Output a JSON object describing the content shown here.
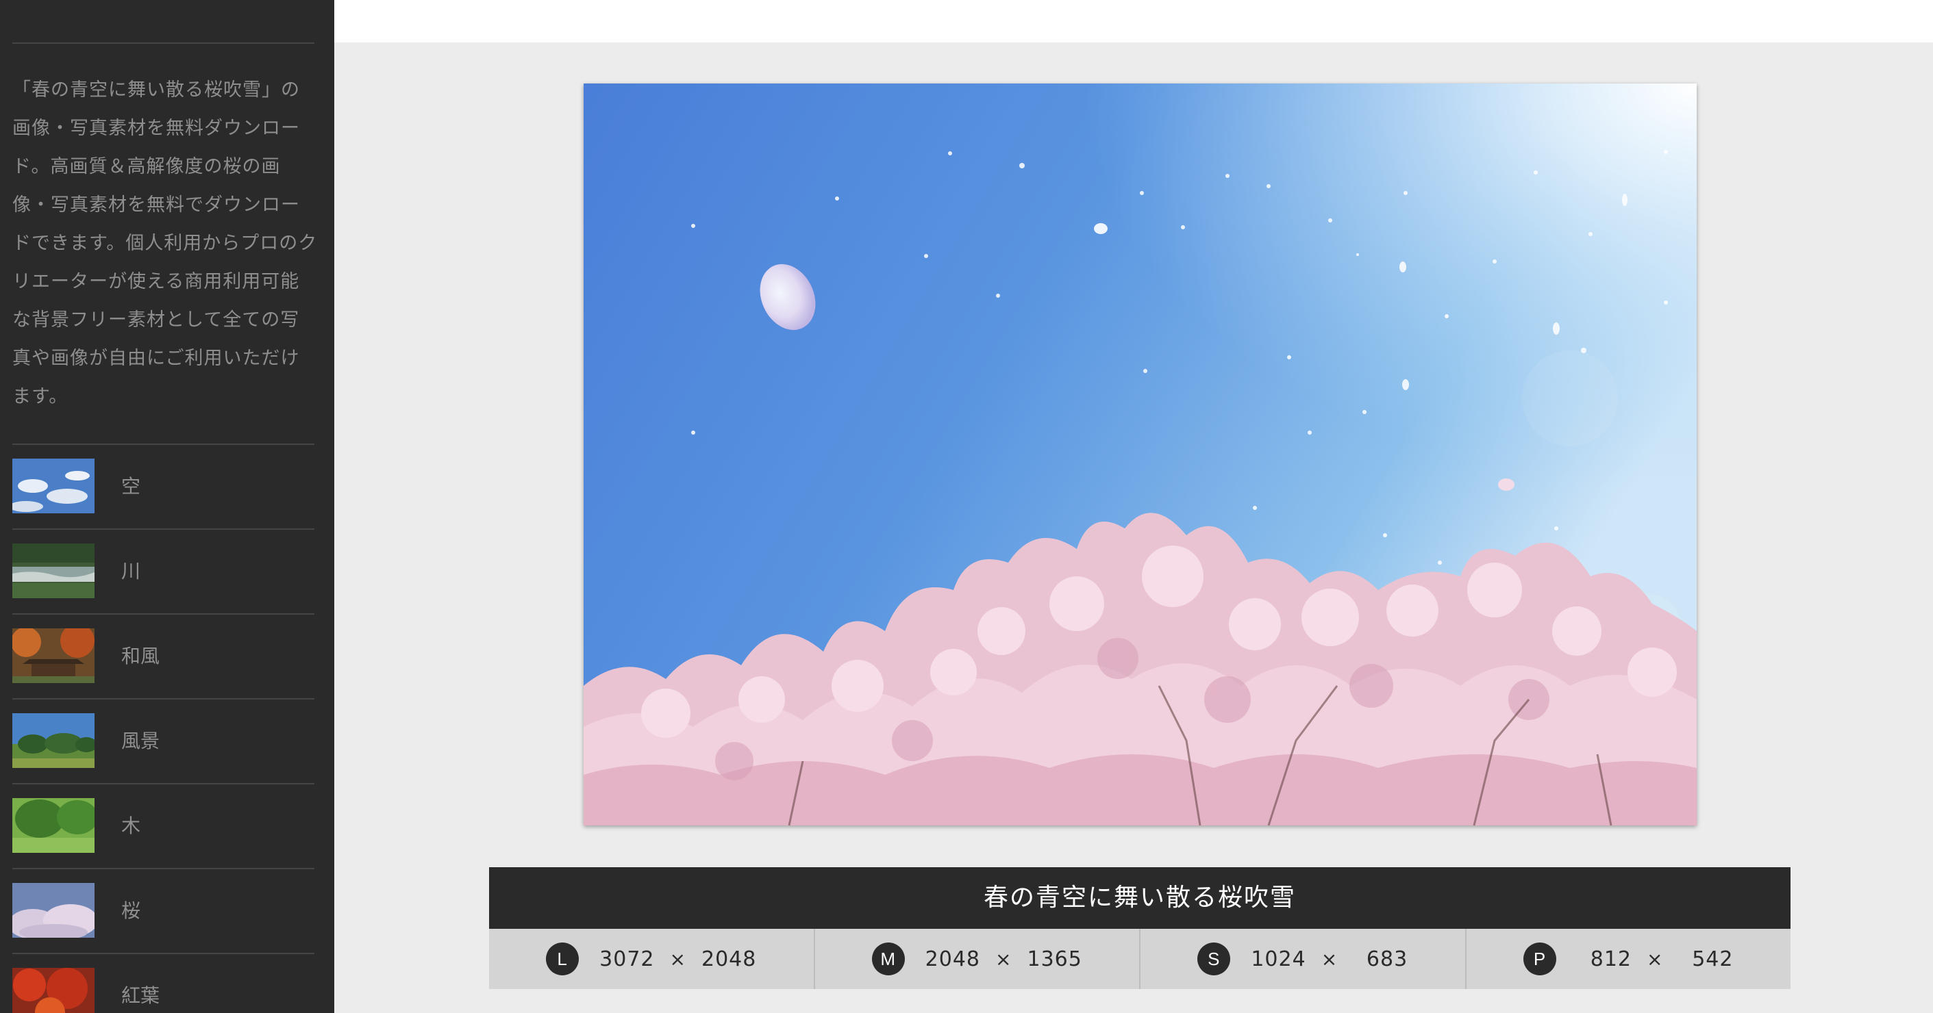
{
  "sidebar": {
    "description": "「春の青空に舞い散る桜吹雪」の画像・写真素材を無料ダウンロード。高画質＆高解像度の桜の画像・写真素材を無料でダウンロードできます。個人利用からプロのクリエーターが使える商用利用可能な背景フリー素材として全ての写真や画像が自由にご利用いただけます。",
    "categories": [
      {
        "label": "空",
        "thumb": "sky"
      },
      {
        "label": "川",
        "thumb": "river"
      },
      {
        "label": "和風",
        "thumb": "japanese-style"
      },
      {
        "label": "風景",
        "thumb": "landscape"
      },
      {
        "label": "木",
        "thumb": "tree"
      },
      {
        "label": "桜",
        "thumb": "cherry-blossom"
      },
      {
        "label": "紅葉",
        "thumb": "autumn-leaves"
      }
    ]
  },
  "photo": {
    "subject": "cherry blossoms against a blue spring sky with falling petals"
  },
  "info": {
    "title": "春の青空に舞い散る桜吹雪",
    "sizes": [
      {
        "badge": "L",
        "width": "3072",
        "height": "2048"
      },
      {
        "badge": "M",
        "width": "2048",
        "height": "1365"
      },
      {
        "badge": "S",
        "width": "1024",
        "height": "683"
      },
      {
        "badge": "P",
        "width": "812",
        "height": "542"
      }
    ],
    "times_symbol": "×"
  },
  "colors": {
    "sidebar_bg": "#2a2a2a",
    "page_bg": "#ececec",
    "title_bar_bg": "#2a2a2a",
    "sizes_bar_bg": "#d4d4d4",
    "sky_blue": "#4f86dc",
    "blossom_pink": "#f2c9d6"
  }
}
